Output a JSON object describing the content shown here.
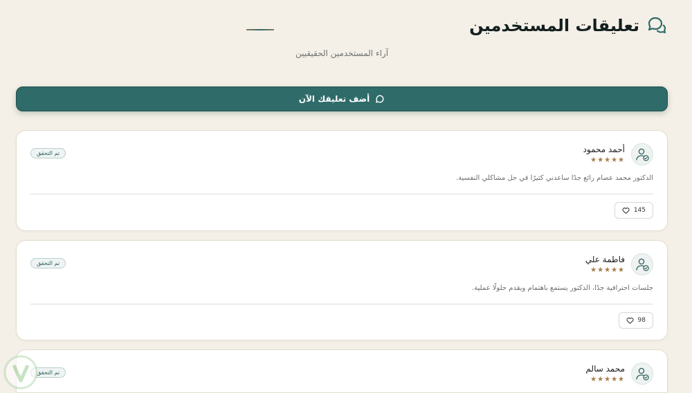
{
  "header": {
    "title": "تعليقات المستخدمين",
    "subtitle": "آراء المستخدمين الحقيقيين"
  },
  "add_button": {
    "label": "أضف تعليقك الآن"
  },
  "reviews": [
    {
      "name": "أحمد محمود",
      "rating": 5,
      "stars": "★★★★★",
      "badge": "تم التحقق",
      "text": "الدكتور محمد عصام رائع جدًا ساعدني كثيرًا في حل مشاكلي النفسية.",
      "likes": "145"
    },
    {
      "name": "فاطمة علي",
      "rating": 5,
      "stars": "★★★★★",
      "badge": "تم التحقق",
      "text": "جلسات احترافية جدًا، الدكتور يستمع باهتمام ويقدم حلولًا عملية.",
      "likes": "98"
    },
    {
      "name": "محمد سالم",
      "rating": 5,
      "stars": "★★★★★",
      "badge": "تم التحقق",
      "text": "",
      "likes": ""
    }
  ],
  "colors": {
    "background": "#f4efe7",
    "primary": "#2e6b69",
    "star": "#a57c4a",
    "card": "#ffffff"
  },
  "icons": {
    "title": "chat-bubbles-icon",
    "add": "comment-icon",
    "avatar": "user-check-icon",
    "like": "heart-icon",
    "watermark": "shield-watermark-icon"
  }
}
